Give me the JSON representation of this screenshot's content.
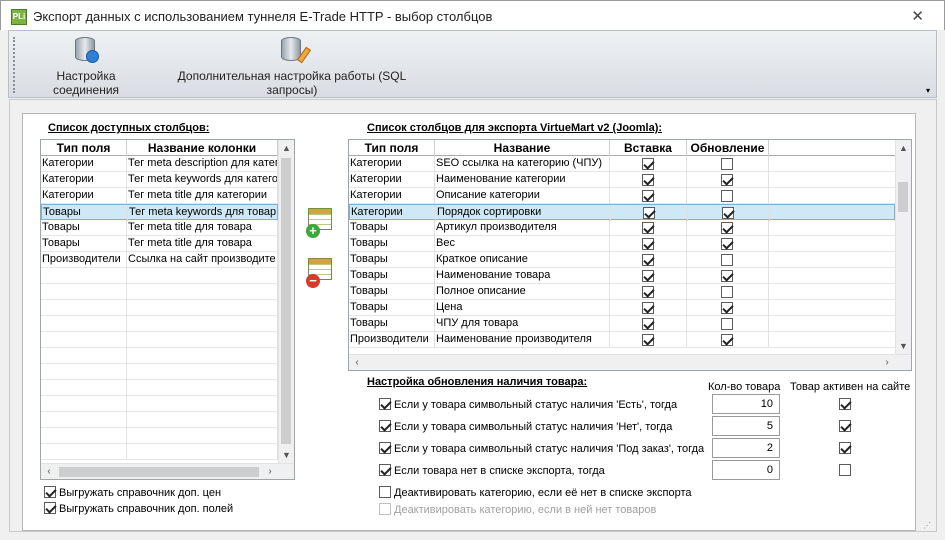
{
  "window": {
    "icon_text": "PLi",
    "title": "Экспорт данных с использованием туннеля E-Trade HTTP - выбор столбцов",
    "close": "✕"
  },
  "toolbar": {
    "connection_label": "Настройка соединения",
    "advanced_label": "Дополнительная настройка работы (SQL запросы)",
    "dropdown": "▾"
  },
  "available": {
    "title": "Список доступных столбцов:",
    "headers": [
      "Тип поля",
      "Название колонки"
    ],
    "rows": [
      [
        "Категории",
        "Тег meta description для катего"
      ],
      [
        "Категории",
        "Тег meta keywords для категор"
      ],
      [
        "Категории",
        "Тег meta title для категории"
      ],
      [
        "Товары",
        "Тег meta keywords для товар"
      ],
      [
        "Товары",
        "Тег meta title для товара"
      ],
      [
        "Товары",
        "Тег meta title для товара"
      ],
      [
        "Производители",
        "Ссылка на сайт производите"
      ]
    ],
    "selected_row": 3,
    "checkbox1": "Выгружать справочник доп. цен",
    "checkbox2": "Выгружать справочник доп. полей"
  },
  "export": {
    "title": "Список столбцов для экспорта VirtueMart v2 (Joomla):",
    "headers": [
      "Тип поля",
      "Название",
      "Вставка",
      "Обновление"
    ],
    "rows": [
      {
        "type": "Категории",
        "name": "SEO ссылка на категорию (ЧПУ)",
        "insert": true,
        "update": false
      },
      {
        "type": "Категории",
        "name": "Наименование категории",
        "insert": true,
        "update": true
      },
      {
        "type": "Категории",
        "name": "Описание категории",
        "insert": true,
        "update": false
      },
      {
        "type": "Категории",
        "name": "Порядок сортировки",
        "insert": true,
        "update": true
      },
      {
        "type": "Товары",
        "name": "Артикул производителя",
        "insert": true,
        "update": true
      },
      {
        "type": "Товары",
        "name": "Вес",
        "insert": true,
        "update": true
      },
      {
        "type": "Товары",
        "name": "Краткое описание",
        "insert": true,
        "update": false
      },
      {
        "type": "Товары",
        "name": "Наименование товара",
        "insert": true,
        "update": true
      },
      {
        "type": "Товары",
        "name": "Полное описание",
        "insert": true,
        "update": false
      },
      {
        "type": "Товары",
        "name": "Цена",
        "insert": true,
        "update": true
      },
      {
        "type": "Товары",
        "name": "ЧПУ для товара",
        "insert": true,
        "update": false
      },
      {
        "type": "Производители",
        "name": "Наименование производителя",
        "insert": true,
        "update": true
      }
    ],
    "selected_row": 3
  },
  "stock": {
    "title": "Настройка обновления наличия товара:",
    "qty_header": "Кол-во товара",
    "active_header": "Товар активен на сайте",
    "rules": [
      {
        "label": "Если у товара символьный статус наличия 'Есть', тогда",
        "checked": true,
        "qty": "10",
        "active": true
      },
      {
        "label": "Если у товара символьный статус наличия 'Нет', тогда",
        "checked": true,
        "qty": "5",
        "active": true
      },
      {
        "label": "Если у товара символьный статус наличия 'Под заказ', тогда",
        "checked": true,
        "qty": "2",
        "active": true
      },
      {
        "label": "Если товара нет в списке экспорта, тогда",
        "checked": true,
        "qty": "0",
        "active": false
      }
    ],
    "deactivate_missing": "Деактивировать категорию, если её нет в списке экспорта",
    "deactivate_empty": "Деактивировать категорию, если в ней нет товаров"
  }
}
